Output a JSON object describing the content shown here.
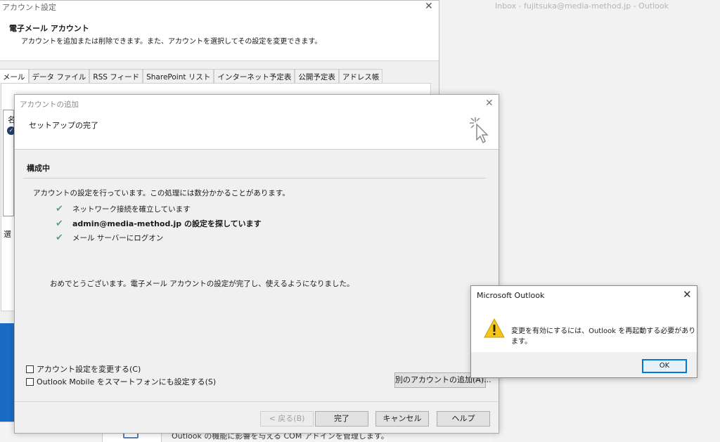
{
  "outlook_window": {
    "title": "Inbox - fujitsuka@media-method.jp  -  Outlook"
  },
  "account_settings": {
    "title": "アカウント設定",
    "close": "✕",
    "heading": "電子メール アカウント",
    "description": "アカウントを追加または削除できます。また、アカウントを選択してその設定を変更できます。",
    "tabs": [
      {
        "label": "メール"
      },
      {
        "label": "データ ファイル"
      },
      {
        "label": "RSS フィード"
      },
      {
        "label": "SharePoint リスト"
      },
      {
        "label": "インターネット予定表"
      },
      {
        "label": "公開予定表"
      },
      {
        "label": "アドレス帳"
      }
    ],
    "list_header": "名",
    "selected_label": "選"
  },
  "bottom": {
    "addin_text": "Outlook の機能に影響を与える COM アドインを管理します。"
  },
  "add_account": {
    "title": "アカウントの追加",
    "close": "✕",
    "heading": "セットアップの完了",
    "section_title": "構成中",
    "info": "アカウントの設定を行っています。この処理には数分かかることがあります。",
    "steps": [
      {
        "text": "ネットワーク接続を確立しています",
        "bold": false
      },
      {
        "text": "admin@media-method.jp の設定を探しています",
        "bold": true
      },
      {
        "text": "メール サーバーにログオン",
        "bold": false
      }
    ],
    "congrats": "おめでとうございます。電子メール アカウントの設定が完了し、使えるようになりました。",
    "checkbox_change": "アカウント設定を変更する(C)",
    "checkbox_mobile": "Outlook Mobile をスマートフォンにも設定する(S)",
    "add_other_button": "別のアカウントの追加(A)...",
    "back_button": "< 戻る(B)",
    "finish_button": "完了",
    "cancel_button": "キャンセル",
    "help_button": "ヘルプ"
  },
  "alert": {
    "title": "Microsoft Outlook",
    "close": "✕",
    "message": "変更を有効にするには、Outlook を再起動する必要があります。",
    "ok_button": "OK"
  },
  "colors": {
    "check_green": "#5aa08a",
    "accent_blue": "#0078d7",
    "warning_yellow": "#f5c518",
    "taskbar_blue": "#1a6bc4"
  },
  "icons": [
    "check-icon",
    "warning-icon",
    "cursor-click-icon",
    "close-icon",
    "addin-icon"
  ]
}
